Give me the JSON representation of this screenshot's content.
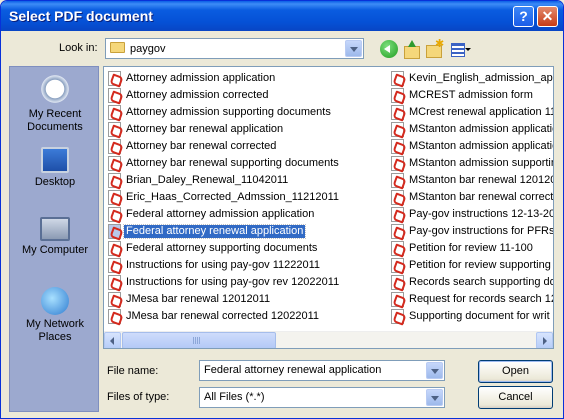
{
  "title": "Select PDF document",
  "title_buttons": {
    "help": "?",
    "close": "✕"
  },
  "look_in": {
    "label": "Look in:",
    "value": "paygov"
  },
  "places": [
    {
      "label": "My Recent Documents",
      "icon": "recent-documents-icon"
    },
    {
      "label": "Desktop",
      "icon": "desktop-icon"
    },
    {
      "label": "My Computer",
      "icon": "my-computer-icon"
    },
    {
      "label": "My Network Places",
      "icon": "network-places-icon"
    }
  ],
  "files_col1": [
    "Attorney admission application",
    "Attorney admission corrected",
    "Attorney admission supporting documents",
    "Attorney bar renewal application",
    "Attorney bar renewal corrected",
    "Attorney bar renewal supporting documents",
    "Brian_Daley_Renewal_11042011",
    "Eric_Haas_Corrected_Admssion_11212011",
    "Federal attorney admission application",
    "Federal attorney renewal application",
    "Federal attorney supporting documents",
    "Instructions for using pay-gov 11222011",
    "Instructions for using pay-gov rev 12022011",
    "JMesa bar renewal 12012011",
    "JMesa bar renewal corrected 12022011"
  ],
  "files_col2": [
    "Kevin_English_admission_app_",
    "MCREST admission form",
    "MCrest renewal application 112",
    "MStanton admission application",
    "MStanton admission application",
    "MStanton admission supporting",
    "MStanton bar renewal 120120",
    "MStanton bar renewal correcte",
    "Pay-gov instructions 12-13-20",
    "Pay-gov instructions for PFRs",
    "Petition for review 11-100",
    "Petition for review supporting",
    "Records search supporting doc",
    "Request for records search 12",
    "Supporting document for writ o"
  ],
  "selected_index": 9,
  "file_name": {
    "label": "File name:",
    "value": "Federal attorney renewal application"
  },
  "file_type": {
    "label": "Files of type:",
    "value": "All Files (*.*)"
  },
  "buttons": {
    "open": "Open",
    "cancel": "Cancel"
  }
}
